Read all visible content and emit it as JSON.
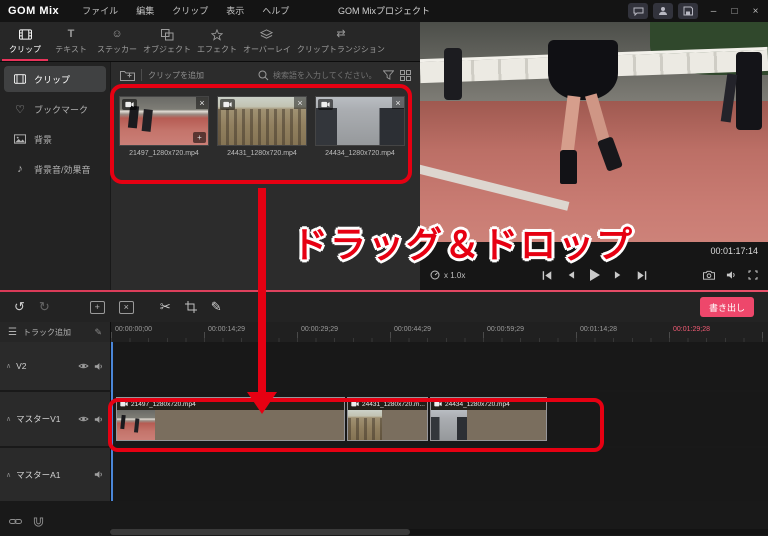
{
  "colors": {
    "accent": "#e8335a",
    "annotation_red": "#e60012",
    "export_button": "#ee476b"
  },
  "icons": {
    "undo": "↺",
    "redo": "↻",
    "scissors": "✂",
    "pen": "✎",
    "hamburger": "☰",
    "heart": "♡",
    "note": "♪",
    "smiley": "☺",
    "transition": "⇄",
    "chevron": "∧",
    "text_tool": "T",
    "close": "×",
    "plus": "+"
  },
  "titlebar": {
    "logo": "GOM Mix",
    "menus": [
      "ファイル",
      "編集",
      "クリップ",
      "表示",
      "ヘルプ"
    ],
    "project_title": "GOM Mixプロジェクト",
    "window": {
      "minimize": "–",
      "maximize": "□",
      "close": "×"
    }
  },
  "tabs": {
    "items": [
      {
        "label": "クリップ"
      },
      {
        "label": "テキスト"
      },
      {
        "label": "ステッカー"
      },
      {
        "label": "オブジェクト"
      },
      {
        "label": "エフェクト"
      },
      {
        "label": "オーバーレイ"
      },
      {
        "label": "クリップトランジション"
      }
    ]
  },
  "sidebar": {
    "items": [
      {
        "label": "クリップ"
      },
      {
        "label": "ブックマーク"
      },
      {
        "label": "背景"
      },
      {
        "label": "背景音/効果音"
      }
    ]
  },
  "clip_panel": {
    "add_clip_label": "クリップを追加",
    "search_placeholder": "検索語を入力してください。",
    "clips": [
      {
        "name": "21497_1280x720.mp4"
      },
      {
        "name": "24431_1280x720.mp4"
      },
      {
        "name": "24434_1280x720.mp4"
      }
    ]
  },
  "preview": {
    "total_time": "00:01:17:14",
    "speed": "x 1.0x"
  },
  "annotation": {
    "drag_drop_text": "ドラッグ＆ドロップ"
  },
  "timeline": {
    "export_label": "書き出し",
    "add_track_label": "トラック追加",
    "ruler": [
      "00:00:00;00",
      "00:00:14;29",
      "00:00:29;29",
      "00:00:44;29",
      "00:00:59;29",
      "00:01:14;28",
      "00:01:29;28"
    ],
    "tracks": [
      {
        "name": "V2"
      },
      {
        "name": "マスターV1"
      },
      {
        "name": "マスターA1"
      }
    ],
    "clips": [
      {
        "label": "21497_1280x720.mp4"
      },
      {
        "label": "24431_1280x720.m..."
      },
      {
        "label": "24434_1280x720.mp4"
      }
    ]
  }
}
